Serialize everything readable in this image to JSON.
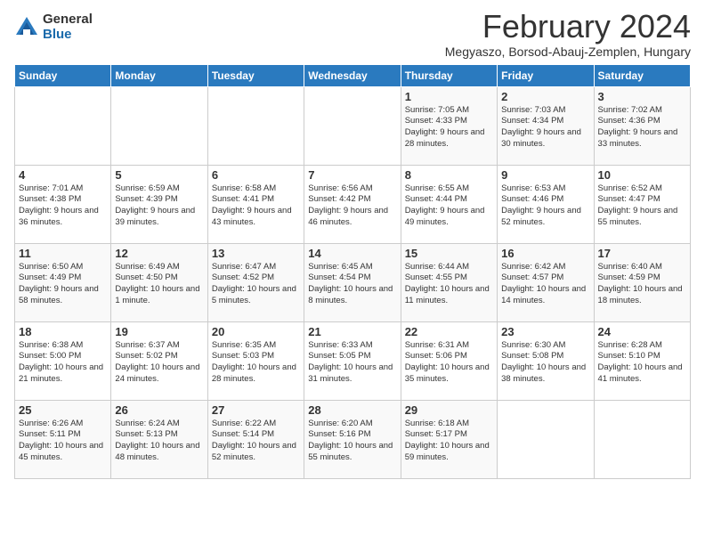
{
  "header": {
    "logo_general": "General",
    "logo_blue": "Blue",
    "title": "February 2024",
    "subtitle": "Megyaszo, Borsod-Abauj-Zemplen, Hungary"
  },
  "days_of_week": [
    "Sunday",
    "Monday",
    "Tuesday",
    "Wednesday",
    "Thursday",
    "Friday",
    "Saturday"
  ],
  "weeks": [
    [
      {
        "day": "",
        "info": ""
      },
      {
        "day": "",
        "info": ""
      },
      {
        "day": "",
        "info": ""
      },
      {
        "day": "",
        "info": ""
      },
      {
        "day": "1",
        "info": "Sunrise: 7:05 AM\nSunset: 4:33 PM\nDaylight: 9 hours and 28 minutes."
      },
      {
        "day": "2",
        "info": "Sunrise: 7:03 AM\nSunset: 4:34 PM\nDaylight: 9 hours and 30 minutes."
      },
      {
        "day": "3",
        "info": "Sunrise: 7:02 AM\nSunset: 4:36 PM\nDaylight: 9 hours and 33 minutes."
      }
    ],
    [
      {
        "day": "4",
        "info": "Sunrise: 7:01 AM\nSunset: 4:38 PM\nDaylight: 9 hours and 36 minutes."
      },
      {
        "day": "5",
        "info": "Sunrise: 6:59 AM\nSunset: 4:39 PM\nDaylight: 9 hours and 39 minutes."
      },
      {
        "day": "6",
        "info": "Sunrise: 6:58 AM\nSunset: 4:41 PM\nDaylight: 9 hours and 43 minutes."
      },
      {
        "day": "7",
        "info": "Sunrise: 6:56 AM\nSunset: 4:42 PM\nDaylight: 9 hours and 46 minutes."
      },
      {
        "day": "8",
        "info": "Sunrise: 6:55 AM\nSunset: 4:44 PM\nDaylight: 9 hours and 49 minutes."
      },
      {
        "day": "9",
        "info": "Sunrise: 6:53 AM\nSunset: 4:46 PM\nDaylight: 9 hours and 52 minutes."
      },
      {
        "day": "10",
        "info": "Sunrise: 6:52 AM\nSunset: 4:47 PM\nDaylight: 9 hours and 55 minutes."
      }
    ],
    [
      {
        "day": "11",
        "info": "Sunrise: 6:50 AM\nSunset: 4:49 PM\nDaylight: 9 hours and 58 minutes."
      },
      {
        "day": "12",
        "info": "Sunrise: 6:49 AM\nSunset: 4:50 PM\nDaylight: 10 hours and 1 minute."
      },
      {
        "day": "13",
        "info": "Sunrise: 6:47 AM\nSunset: 4:52 PM\nDaylight: 10 hours and 5 minutes."
      },
      {
        "day": "14",
        "info": "Sunrise: 6:45 AM\nSunset: 4:54 PM\nDaylight: 10 hours and 8 minutes."
      },
      {
        "day": "15",
        "info": "Sunrise: 6:44 AM\nSunset: 4:55 PM\nDaylight: 10 hours and 11 minutes."
      },
      {
        "day": "16",
        "info": "Sunrise: 6:42 AM\nSunset: 4:57 PM\nDaylight: 10 hours and 14 minutes."
      },
      {
        "day": "17",
        "info": "Sunrise: 6:40 AM\nSunset: 4:59 PM\nDaylight: 10 hours and 18 minutes."
      }
    ],
    [
      {
        "day": "18",
        "info": "Sunrise: 6:38 AM\nSunset: 5:00 PM\nDaylight: 10 hours and 21 minutes."
      },
      {
        "day": "19",
        "info": "Sunrise: 6:37 AM\nSunset: 5:02 PM\nDaylight: 10 hours and 24 minutes."
      },
      {
        "day": "20",
        "info": "Sunrise: 6:35 AM\nSunset: 5:03 PM\nDaylight: 10 hours and 28 minutes."
      },
      {
        "day": "21",
        "info": "Sunrise: 6:33 AM\nSunset: 5:05 PM\nDaylight: 10 hours and 31 minutes."
      },
      {
        "day": "22",
        "info": "Sunrise: 6:31 AM\nSunset: 5:06 PM\nDaylight: 10 hours and 35 minutes."
      },
      {
        "day": "23",
        "info": "Sunrise: 6:30 AM\nSunset: 5:08 PM\nDaylight: 10 hours and 38 minutes."
      },
      {
        "day": "24",
        "info": "Sunrise: 6:28 AM\nSunset: 5:10 PM\nDaylight: 10 hours and 41 minutes."
      }
    ],
    [
      {
        "day": "25",
        "info": "Sunrise: 6:26 AM\nSunset: 5:11 PM\nDaylight: 10 hours and 45 minutes."
      },
      {
        "day": "26",
        "info": "Sunrise: 6:24 AM\nSunset: 5:13 PM\nDaylight: 10 hours and 48 minutes."
      },
      {
        "day": "27",
        "info": "Sunrise: 6:22 AM\nSunset: 5:14 PM\nDaylight: 10 hours and 52 minutes."
      },
      {
        "day": "28",
        "info": "Sunrise: 6:20 AM\nSunset: 5:16 PM\nDaylight: 10 hours and 55 minutes."
      },
      {
        "day": "29",
        "info": "Sunrise: 6:18 AM\nSunset: 5:17 PM\nDaylight: 10 hours and 59 minutes."
      },
      {
        "day": "",
        "info": ""
      },
      {
        "day": "",
        "info": ""
      }
    ]
  ]
}
